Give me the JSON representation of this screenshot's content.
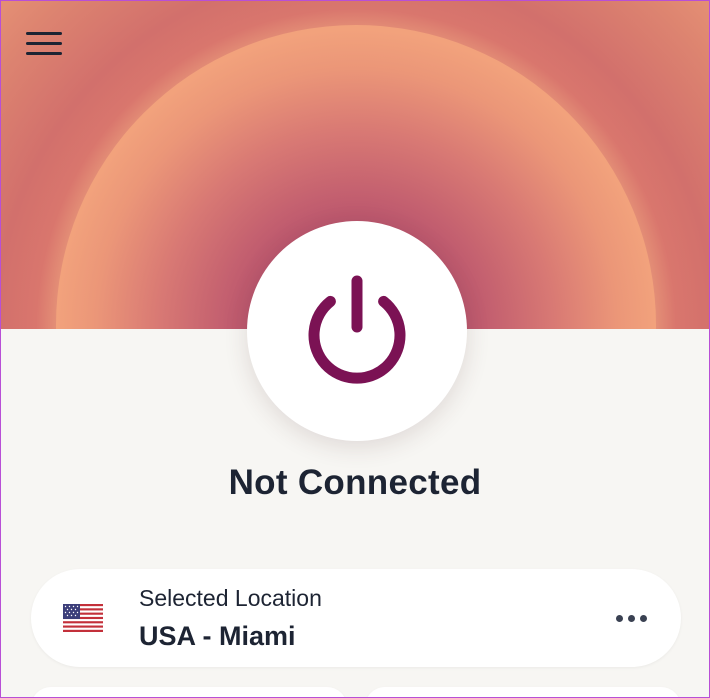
{
  "app": {
    "status_text": "Not Connected",
    "colors": {
      "accent": "#7b1254",
      "text": "#1d2433",
      "background": "#f7f6f3",
      "hero_orange": "#f0a07b",
      "hero_magenta": "#a13f63"
    }
  },
  "menu": {
    "icon": "hamburger-menu-icon"
  },
  "power_button": {
    "icon": "power-icon"
  },
  "location": {
    "label": "Selected Location",
    "value": "USA - Miami",
    "flag_icon": "us-flag-icon",
    "more_icon": "more-options-icon"
  }
}
